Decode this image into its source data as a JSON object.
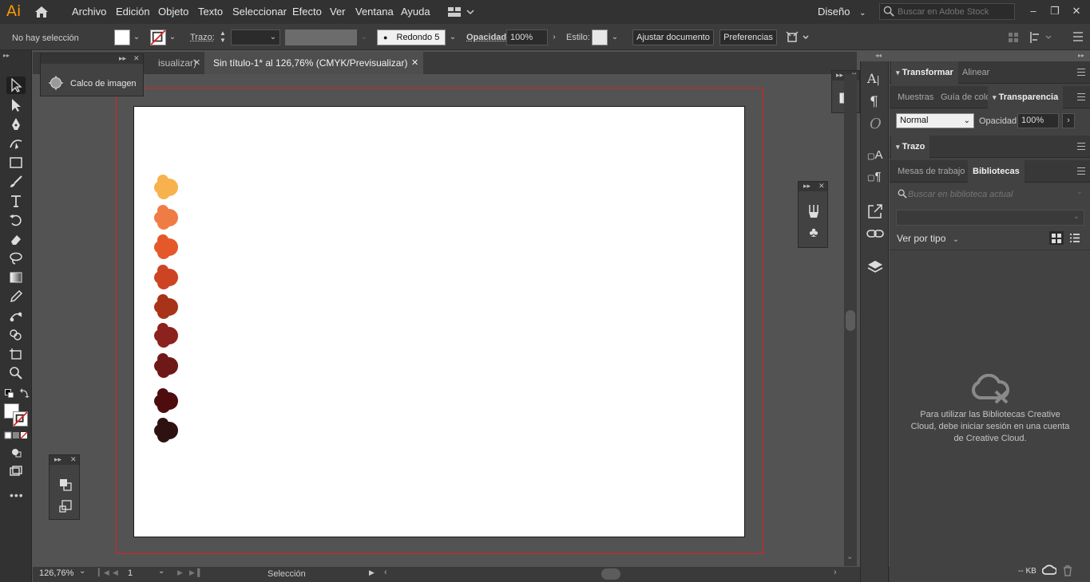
{
  "app": {
    "logo": "Ai"
  },
  "menu": {
    "items": [
      "Archivo",
      "Edición",
      "Objeto",
      "Texto",
      "Seleccionar",
      "Efecto",
      "Ver",
      "Ventana",
      "Ayuda"
    ],
    "workspace": "Diseño",
    "stock_placeholder": "Buscar en Adobe Stock"
  },
  "control": {
    "selection_status": "No hay selección",
    "stroke_label": "Trazo:",
    "brush_label": "Redondo 5 ...",
    "opacity_label": "Opacidad:",
    "opacity_value": "100%",
    "style_label": "Estilo:",
    "adjust_button": "Ajustar documento",
    "prefs_button": "Preferencias"
  },
  "tabs": {
    "tab1": "isualizar)",
    "tab2": "Sin título-1* al 126,76% (CMYK/Previsualizar)"
  },
  "float_trace": {
    "label": "Calco de imagen"
  },
  "status": {
    "zoom": "126,76%",
    "artboard_num": "1",
    "tool_label": "Selección",
    "kb": "-- KB"
  },
  "right_panel": {
    "group1": {
      "tab_a": "Transformar",
      "tab_b": "Alinear"
    },
    "group2": {
      "tab_a": "Muestras",
      "tab_b": "Guía de colo",
      "tab_c": "Transparencia"
    },
    "blend_mode": "Normal",
    "opacity_label": "Opacidad:",
    "opacity_value": "100%",
    "trazo_title": "Trazo",
    "group3": {
      "tab_a": "Mesas de trabajo",
      "tab_b": "Bibliotecas"
    },
    "lib_search_placeholder": "Buscar en biblioteca actual",
    "view_by": "Ver por tipo",
    "lib_message": "Para utilizar las Bibliotecas Creative Cloud, debe iniciar sesión en una cuenta de Creative Cloud."
  },
  "palette": {
    "colors": [
      "#f8b24d",
      "#ef7c45",
      "#e5582a",
      "#cc4423",
      "#a83318",
      "#8c221d",
      "#6f1818",
      "#4d0c0e",
      "#2e1111"
    ]
  },
  "accent": {
    "artboard_bleed": "#e02020",
    "logo": "#ff9a00"
  }
}
